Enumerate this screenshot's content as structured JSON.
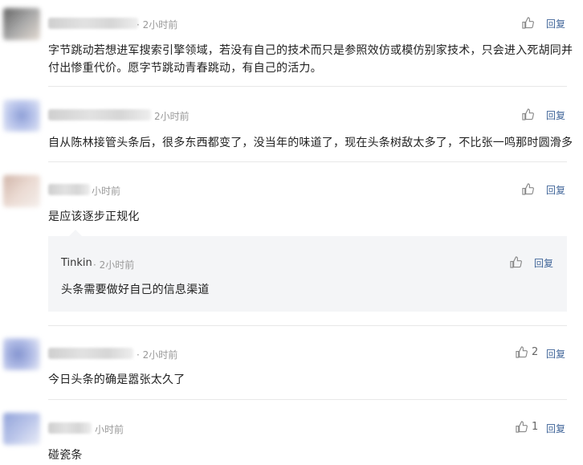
{
  "reply_label": "回复",
  "comments": [
    {
      "time": "· 2小时前",
      "content": "字节跳动若想进军搜索引擎领域，若没有自己的技术而只是参照效仿或模仿别家技术，只会进入死胡同并付出惨重代价。愿字节跳动青春跳动，有自己的活力。",
      "line1": "字节跳动若想进军搜索引擎领域，若没有自己的技术而只是参照效仿或模仿别家技术，只会进入死胡同并",
      "line2": "付出惨重代价。愿字节跳动青春跳动，有自己的活力。",
      "likes": ""
    },
    {
      "time": "2小时前",
      "content": "自从陈林接管头条后，很多东西都变了，没当年的味道了，现在头条树敌太多了，不比张一鸣那时圆滑多",
      "likes": ""
    },
    {
      "time": "小时前",
      "content": "是应该逐步正规化",
      "likes": "",
      "reply": {
        "user": "Tinkin",
        "time": "· 2小时前",
        "content": "头条需要做好自己的信息渠道",
        "likes": ""
      }
    },
    {
      "time": "· 2小时前",
      "content": "今日头条的确是嚣张太久了",
      "likes": "2"
    },
    {
      "time": "小时前",
      "content": "碰瓷条",
      "likes": "1"
    }
  ],
  "colors": {
    "reply_link": "#406599",
    "meta": "#999999",
    "subreply_bg": "#f4f5f7"
  },
  "icons": {
    "like": "thumbs-up-icon"
  }
}
